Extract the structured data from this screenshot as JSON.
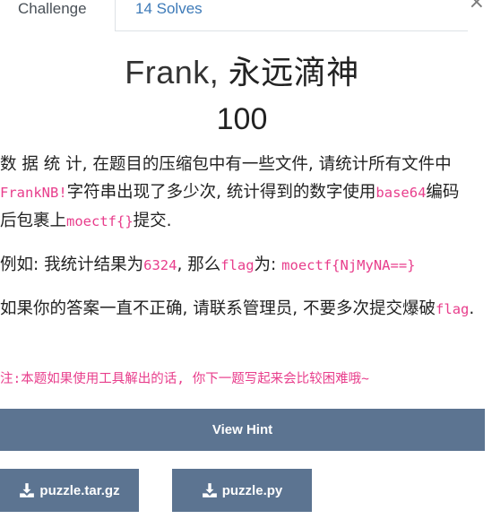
{
  "tabs": {
    "challenge": "Challenge",
    "solves": "14 Solves"
  },
  "close_symbol": "×",
  "challenge": {
    "name_latin": "Frank, ",
    "name_cjk": "永远滴神",
    "value": "100"
  },
  "description": {
    "p1_part1": "数 据 统 计, 在题目的压缩包中有一些文件, 请统计所有文件中",
    "p1_code1": "FrankNB!",
    "p1_part2": "字符串出现了多少次, 统计得到的数字使用",
    "p1_code2": "base64",
    "p1_part3": "编码后包裹上",
    "p1_code3": "moectf{}",
    "p1_part4": "提交.",
    "p2_part1": "例如: 我统计结果为",
    "p2_code1": "6324",
    "p2_part2": ", 那么",
    "p2_code2": "flag",
    "p2_part3": "为: ",
    "p2_code3": "moectf{NjMyNA==}",
    "p3_part1": "如果你的答案一直不正确, 请联系管理员, 不要多次提交爆破",
    "p3_code1": "flag",
    "p3_part2": ".",
    "note": "注:本题如果使用工具解出的话, 你下一题写起来会比较困难哦~"
  },
  "hint_button": "View Hint",
  "files": [
    {
      "label": "puzzle.tar.gz",
      "icon": "download-icon"
    },
    {
      "label": "puzzle.py",
      "icon": "download-icon"
    }
  ],
  "colors": {
    "button_bg": "#5c7491",
    "code": "#e83e8c",
    "tab_link": "#3d7ab8"
  }
}
